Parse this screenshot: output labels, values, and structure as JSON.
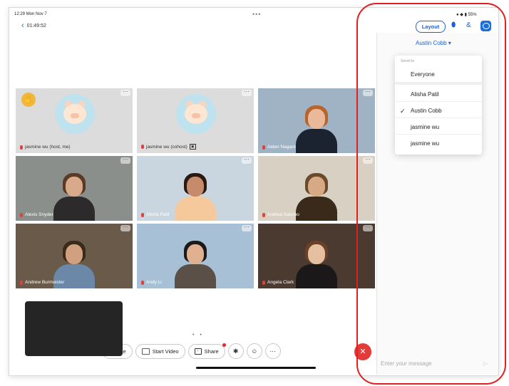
{
  "status": {
    "time": "12:29",
    "date": "Mon Nov 7",
    "battery": "55%",
    "more_dots": "•••"
  },
  "meeting": {
    "back_icon": "chevron-left-icon",
    "timer": "01:49:52"
  },
  "tiles": [
    {
      "name": "jasmine wu (host, me)",
      "type": "avatar",
      "hand_raised": true,
      "hand_icon": "raise-hand-icon"
    },
    {
      "name": "jasmine wu (cohost)",
      "type": "avatar",
      "hand_raised": false
    },
    {
      "name": "Aiden Nagant",
      "type": "video",
      "bg": "#9fb3c4",
      "skin": "#e9b99a",
      "hair": "#b8652d",
      "shirt": "#1b2330"
    },
    {
      "name": "Alexis Snyder",
      "type": "video",
      "bg": "#8a8f8c",
      "skin": "#d8a98a",
      "hair": "#5a3a24",
      "shirt": "#2c2a2a"
    },
    {
      "name": "Alisha Patil",
      "type": "video",
      "bg": "#c9d6e0",
      "skin": "#c58b6b",
      "hair": "#2a1a14",
      "shirt": "#f5c99b"
    },
    {
      "name": "Andrea Sancho",
      "type": "video",
      "bg": "#d8d0c2",
      "skin": "#d8a985",
      "hair": "#6a4a2a",
      "shirt": "#3a2a1a"
    },
    {
      "name": "Andrew Burmeister",
      "type": "video",
      "bg": "#6a5a4a",
      "skin": "#d0a080",
      "hair": "#3a2a1a",
      "shirt": "#6b88a8"
    },
    {
      "name": "Andy Li",
      "type": "video",
      "bg": "#a8c0d6",
      "skin": "#e0b090",
      "hair": "#1a1a1a",
      "shirt": "#5a5048"
    },
    {
      "name": "Angela Clark",
      "type": "video",
      "bg": "#4a3a30",
      "skin": "#e4c0a0",
      "hair": "#6a4028",
      "shirt": "#1a1818"
    }
  ],
  "pager_dots": "• •",
  "toolbar": {
    "mute_label": "mute",
    "start_video_label": "Start Video",
    "share_label": "Share",
    "bluetooth_icon": "bluetooth-icon",
    "reactions_icon": "smiley-icon",
    "more_icon": "ellipsis-icon",
    "leave_icon": "close-icon"
  },
  "panel": {
    "layout_label": "Layout",
    "recipient": "Austin Cobb ▾",
    "send_to_header": "Send to",
    "options": [
      "Everyone",
      "Alisha Patil",
      "Austin Cobb",
      "jasmine wu",
      "jasmine wu"
    ],
    "selected": "Austin Cobb",
    "message_placeholder": "Enter your message",
    "send_icon": "send-icon"
  },
  "colors": {
    "accent": "#1c60d8",
    "leave": "#e43a3a",
    "highlight": "#e02020"
  }
}
